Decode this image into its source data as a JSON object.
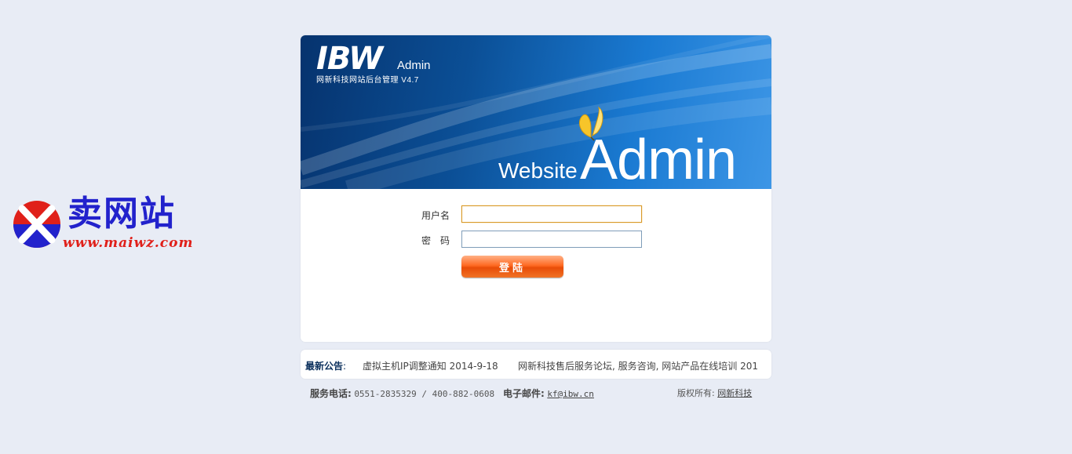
{
  "watermark": {
    "title": "卖网站",
    "url": "www.maiwz.com"
  },
  "header": {
    "brand": "IBW",
    "brand_suffix": "Admin",
    "subtitle": "网新科技网站后台管理 V4.7",
    "hero_small": "Website",
    "hero_large": "Admin",
    "colors": {
      "banner_dark": "#06336e",
      "banner_light": "#3d96e6",
      "brand_accent": "#e8342a"
    }
  },
  "form": {
    "username_label": "用户名",
    "username_value": "",
    "password_label": "密　码",
    "password_value": "",
    "submit_label": "登陆",
    "submit_color": "#ff6a22"
  },
  "notice": {
    "label": "最新公告",
    "colon": ":",
    "items": [
      "虚拟主机IP调整通知 2014-9-18",
      "网新科技售后服务论坛, 服务咨询, 网站产品在线培训 201"
    ]
  },
  "footer": {
    "phone_label": "服务电话:",
    "phone_value": "0551-2835329 / 400-882-0608",
    "email_label": "电子邮件:",
    "email_value": "kf@ibw.cn",
    "copyright_label": "版权所有:",
    "copyright_value": "网新科技"
  }
}
